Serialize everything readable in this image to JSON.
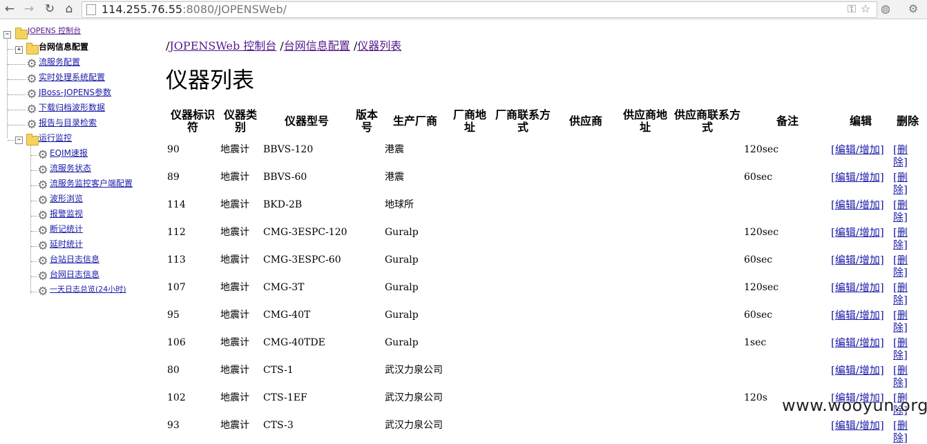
{
  "browser": {
    "url_host": "114.255.76.55",
    "url_rest": ":8080/JOPENSWeb/",
    "back_icon": "←",
    "forward_icon": "→",
    "reload_icon": "↻",
    "home_icon": "⌂",
    "star_icon": "☆",
    "wrench_icon": "⚙"
  },
  "tree": {
    "root_label": "JOPENS 控制台",
    "expand_plus": "+",
    "collapse_minus": "−",
    "gear_glyph": "⚙",
    "items": [
      {
        "label": "台网信息配置"
      },
      {
        "label": "流服务配置"
      },
      {
        "label": "实时处理系统配置"
      },
      {
        "label": "JBoss-JOPENS参数"
      },
      {
        "label": "下载归档波形数据"
      },
      {
        "label": "报告与目录检索"
      },
      {
        "label": "运行监控"
      }
    ],
    "monitor_children": [
      {
        "label": "EQIM速报"
      },
      {
        "label": "流服务状态"
      },
      {
        "label": "流服务监控客户端配置"
      },
      {
        "label": "波形浏览"
      },
      {
        "label": "报警监视"
      },
      {
        "label": "断记统计"
      },
      {
        "label": "延时统计"
      },
      {
        "label": "台站日志信息"
      },
      {
        "label": "台网日志信息"
      },
      {
        "label": "一天日志总览(24小时)"
      }
    ]
  },
  "breadcrumb": {
    "sep": "/",
    "items": [
      "JOPENSWeb 控制台",
      "台网信息配置",
      "仪器列表"
    ]
  },
  "page_title": "仪器列表",
  "table": {
    "headers": {
      "id": "仪器标识符",
      "type": "仪器类别",
      "model": "仪器型号",
      "version": "版本号",
      "maker": "生产厂商",
      "maker_addr": "厂商地址",
      "maker_contact": "厂商联系方式",
      "supplier": "供应商",
      "supplier_addr": "供应商地址",
      "supplier_contact": "供应商联系方式",
      "note": "备注",
      "edit": "编辑",
      "delete": "删除"
    },
    "edit_link": "[编辑/增加]",
    "delete_link": "[删除]",
    "rows": [
      {
        "id": "90",
        "type": "地震计",
        "model": "BBVS-120",
        "maker": "港震",
        "note": "120sec"
      },
      {
        "id": "89",
        "type": "地震计",
        "model": "BBVS-60",
        "maker": "港震",
        "note": "60sec"
      },
      {
        "id": "114",
        "type": "地震计",
        "model": "BKD-2B",
        "maker": "地球所",
        "note": ""
      },
      {
        "id": "112",
        "type": "地震计",
        "model": "CMG-3ESPC-120",
        "maker": "Guralp",
        "note": "120sec"
      },
      {
        "id": "113",
        "type": "地震计",
        "model": "CMG-3ESPC-60",
        "maker": "Guralp",
        "note": "60sec"
      },
      {
        "id": "107",
        "type": "地震计",
        "model": "CMG-3T",
        "maker": "Guralp",
        "note": "120sec"
      },
      {
        "id": "95",
        "type": "地震计",
        "model": "CMG-40T",
        "maker": "Guralp",
        "note": "60sec"
      },
      {
        "id": "106",
        "type": "地震计",
        "model": "CMG-40TDE",
        "maker": "Guralp",
        "note": "1sec"
      },
      {
        "id": "80",
        "type": "地震计",
        "model": "CTS-1",
        "maker": "武汉力泉公司",
        "note": ""
      },
      {
        "id": "102",
        "type": "地震计",
        "model": "CTS-1EF",
        "maker": "武汉力泉公司",
        "note": "120s"
      },
      {
        "id": "93",
        "type": "地震计",
        "model": "CTS-3",
        "maker": "武汉力泉公司",
        "note": ""
      }
    ]
  },
  "watermark": "www.wooyun.org"
}
